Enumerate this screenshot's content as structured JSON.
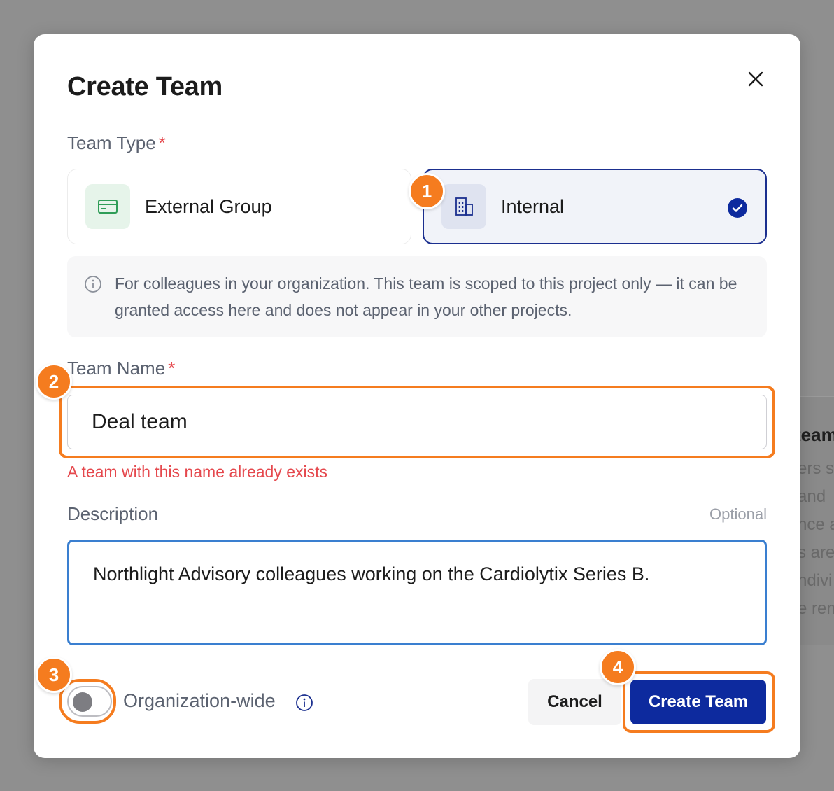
{
  "background": {
    "title": "team",
    "lines": [
      "ers s",
      "and",
      "nce a",
      "s are",
      "ndivi",
      "e rem"
    ]
  },
  "modal": {
    "title": "Create Team",
    "close_icon": "close-icon",
    "team_type": {
      "label": "Team Type",
      "required_mark": "*",
      "options": [
        {
          "label": "External Group",
          "icon": "credit-card-icon",
          "selected": false
        },
        {
          "label": "Internal",
          "icon": "building-icon",
          "selected": true
        }
      ],
      "info_text": "For colleagues in your organization. This team is scoped to this project only — it can be granted access here and does not appear in your other projects."
    },
    "team_name": {
      "label": "Team Name",
      "required_mark": "*",
      "value": "Deal team",
      "error": "A team with this name already exists"
    },
    "description": {
      "label": "Description",
      "optional_label": "Optional",
      "value": "Northlight Advisory colleagues working on the Cardiolytix Series B."
    },
    "organization_wide": {
      "label": "Organization-wide",
      "enabled": false
    },
    "buttons": {
      "cancel": "Cancel",
      "create": "Create Team"
    }
  },
  "annotations": [
    "1",
    "2",
    "3",
    "4"
  ],
  "colors": {
    "accent": "#0d2a9e",
    "error": "#e5484d",
    "annotation": "#f57c1f",
    "focus": "#3a7fd0"
  }
}
